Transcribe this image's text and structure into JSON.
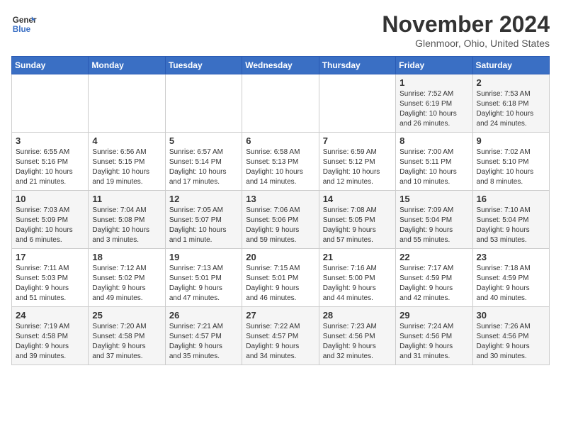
{
  "logo": {
    "name": "General",
    "name2": "Blue"
  },
  "header": {
    "month": "November 2024",
    "location": "Glenmoor, Ohio, United States"
  },
  "days_of_week": [
    "Sunday",
    "Monday",
    "Tuesday",
    "Wednesday",
    "Thursday",
    "Friday",
    "Saturday"
  ],
  "weeks": [
    [
      {
        "day": "",
        "detail": ""
      },
      {
        "day": "",
        "detail": ""
      },
      {
        "day": "",
        "detail": ""
      },
      {
        "day": "",
        "detail": ""
      },
      {
        "day": "",
        "detail": ""
      },
      {
        "day": "1",
        "detail": "Sunrise: 7:52 AM\nSunset: 6:19 PM\nDaylight: 10 hours\nand 26 minutes."
      },
      {
        "day": "2",
        "detail": "Sunrise: 7:53 AM\nSunset: 6:18 PM\nDaylight: 10 hours\nand 24 minutes."
      }
    ],
    [
      {
        "day": "3",
        "detail": "Sunrise: 6:55 AM\nSunset: 5:16 PM\nDaylight: 10 hours\nand 21 minutes."
      },
      {
        "day": "4",
        "detail": "Sunrise: 6:56 AM\nSunset: 5:15 PM\nDaylight: 10 hours\nand 19 minutes."
      },
      {
        "day": "5",
        "detail": "Sunrise: 6:57 AM\nSunset: 5:14 PM\nDaylight: 10 hours\nand 17 minutes."
      },
      {
        "day": "6",
        "detail": "Sunrise: 6:58 AM\nSunset: 5:13 PM\nDaylight: 10 hours\nand 14 minutes."
      },
      {
        "day": "7",
        "detail": "Sunrise: 6:59 AM\nSunset: 5:12 PM\nDaylight: 10 hours\nand 12 minutes."
      },
      {
        "day": "8",
        "detail": "Sunrise: 7:00 AM\nSunset: 5:11 PM\nDaylight: 10 hours\nand 10 minutes."
      },
      {
        "day": "9",
        "detail": "Sunrise: 7:02 AM\nSunset: 5:10 PM\nDaylight: 10 hours\nand 8 minutes."
      }
    ],
    [
      {
        "day": "10",
        "detail": "Sunrise: 7:03 AM\nSunset: 5:09 PM\nDaylight: 10 hours\nand 6 minutes."
      },
      {
        "day": "11",
        "detail": "Sunrise: 7:04 AM\nSunset: 5:08 PM\nDaylight: 10 hours\nand 3 minutes."
      },
      {
        "day": "12",
        "detail": "Sunrise: 7:05 AM\nSunset: 5:07 PM\nDaylight: 10 hours\nand 1 minute."
      },
      {
        "day": "13",
        "detail": "Sunrise: 7:06 AM\nSunset: 5:06 PM\nDaylight: 9 hours\nand 59 minutes."
      },
      {
        "day": "14",
        "detail": "Sunrise: 7:08 AM\nSunset: 5:05 PM\nDaylight: 9 hours\nand 57 minutes."
      },
      {
        "day": "15",
        "detail": "Sunrise: 7:09 AM\nSunset: 5:04 PM\nDaylight: 9 hours\nand 55 minutes."
      },
      {
        "day": "16",
        "detail": "Sunrise: 7:10 AM\nSunset: 5:04 PM\nDaylight: 9 hours\nand 53 minutes."
      }
    ],
    [
      {
        "day": "17",
        "detail": "Sunrise: 7:11 AM\nSunset: 5:03 PM\nDaylight: 9 hours\nand 51 minutes."
      },
      {
        "day": "18",
        "detail": "Sunrise: 7:12 AM\nSunset: 5:02 PM\nDaylight: 9 hours\nand 49 minutes."
      },
      {
        "day": "19",
        "detail": "Sunrise: 7:13 AM\nSunset: 5:01 PM\nDaylight: 9 hours\nand 47 minutes."
      },
      {
        "day": "20",
        "detail": "Sunrise: 7:15 AM\nSunset: 5:01 PM\nDaylight: 9 hours\nand 46 minutes."
      },
      {
        "day": "21",
        "detail": "Sunrise: 7:16 AM\nSunset: 5:00 PM\nDaylight: 9 hours\nand 44 minutes."
      },
      {
        "day": "22",
        "detail": "Sunrise: 7:17 AM\nSunset: 4:59 PM\nDaylight: 9 hours\nand 42 minutes."
      },
      {
        "day": "23",
        "detail": "Sunrise: 7:18 AM\nSunset: 4:59 PM\nDaylight: 9 hours\nand 40 minutes."
      }
    ],
    [
      {
        "day": "24",
        "detail": "Sunrise: 7:19 AM\nSunset: 4:58 PM\nDaylight: 9 hours\nand 39 minutes."
      },
      {
        "day": "25",
        "detail": "Sunrise: 7:20 AM\nSunset: 4:58 PM\nDaylight: 9 hours\nand 37 minutes."
      },
      {
        "day": "26",
        "detail": "Sunrise: 7:21 AM\nSunset: 4:57 PM\nDaylight: 9 hours\nand 35 minutes."
      },
      {
        "day": "27",
        "detail": "Sunrise: 7:22 AM\nSunset: 4:57 PM\nDaylight: 9 hours\nand 34 minutes."
      },
      {
        "day": "28",
        "detail": "Sunrise: 7:23 AM\nSunset: 4:56 PM\nDaylight: 9 hours\nand 32 minutes."
      },
      {
        "day": "29",
        "detail": "Sunrise: 7:24 AM\nSunset: 4:56 PM\nDaylight: 9 hours\nand 31 minutes."
      },
      {
        "day": "30",
        "detail": "Sunrise: 7:26 AM\nSunset: 4:56 PM\nDaylight: 9 hours\nand 30 minutes."
      }
    ]
  ]
}
